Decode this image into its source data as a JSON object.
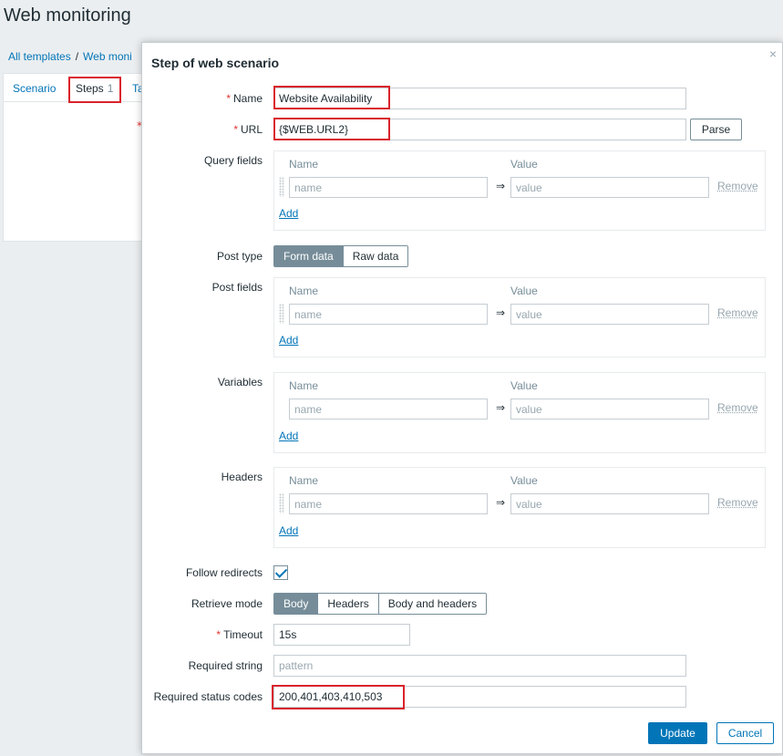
{
  "page": {
    "title": "Web monitoring",
    "breadcrumb": [
      "All templates",
      "Web moni"
    ],
    "tabs": [
      {
        "label": "Scenario"
      },
      {
        "label": "Steps",
        "count": "1"
      },
      {
        "label": "Ta"
      }
    ]
  },
  "dialog": {
    "title": "Step of web scenario",
    "close_symbol": "×",
    "name": {
      "label": "Name",
      "value": "Website Availability"
    },
    "url": {
      "label": "URL",
      "value": "{$WEB.URL2}",
      "parse_button": "Parse"
    },
    "query_fields": {
      "label": "Query fields",
      "col_name": "Name",
      "col_value": "Value",
      "name_placeholder": "name",
      "value_placeholder": "value",
      "arrow": "⇒",
      "remove": "Remove",
      "add": "Add"
    },
    "post_type": {
      "label": "Post type",
      "options": [
        "Form data",
        "Raw data"
      ],
      "selected": "Form data"
    },
    "post_fields": {
      "label": "Post fields",
      "col_name": "Name",
      "col_value": "Value",
      "name_placeholder": "name",
      "value_placeholder": "value",
      "arrow": "⇒",
      "remove": "Remove",
      "add": "Add"
    },
    "variables": {
      "label": "Variables",
      "col_name": "Name",
      "col_value": "Value",
      "name_placeholder": "name",
      "value_placeholder": "value",
      "arrow": "⇒",
      "remove": "Remove",
      "add": "Add"
    },
    "headers": {
      "label": "Headers",
      "col_name": "Name",
      "col_value": "Value",
      "name_placeholder": "name",
      "value_placeholder": "value",
      "arrow": "⇒",
      "remove": "Remove",
      "add": "Add"
    },
    "follow_redirects": {
      "label": "Follow redirects",
      "checked": true
    },
    "retrieve_mode": {
      "label": "Retrieve mode",
      "options": [
        "Body",
        "Headers",
        "Body and headers"
      ],
      "selected": "Body"
    },
    "timeout": {
      "label": "Timeout",
      "value": "15s"
    },
    "required_string": {
      "label": "Required string",
      "placeholder": "pattern"
    },
    "required_status_codes": {
      "label": "Required status codes",
      "value": "200,401,403,410,503"
    },
    "buttons": {
      "update": "Update",
      "cancel": "Cancel"
    }
  },
  "colors": {
    "accent": "#0275b8",
    "required": "#e33734",
    "highlight": "#d9232c"
  }
}
